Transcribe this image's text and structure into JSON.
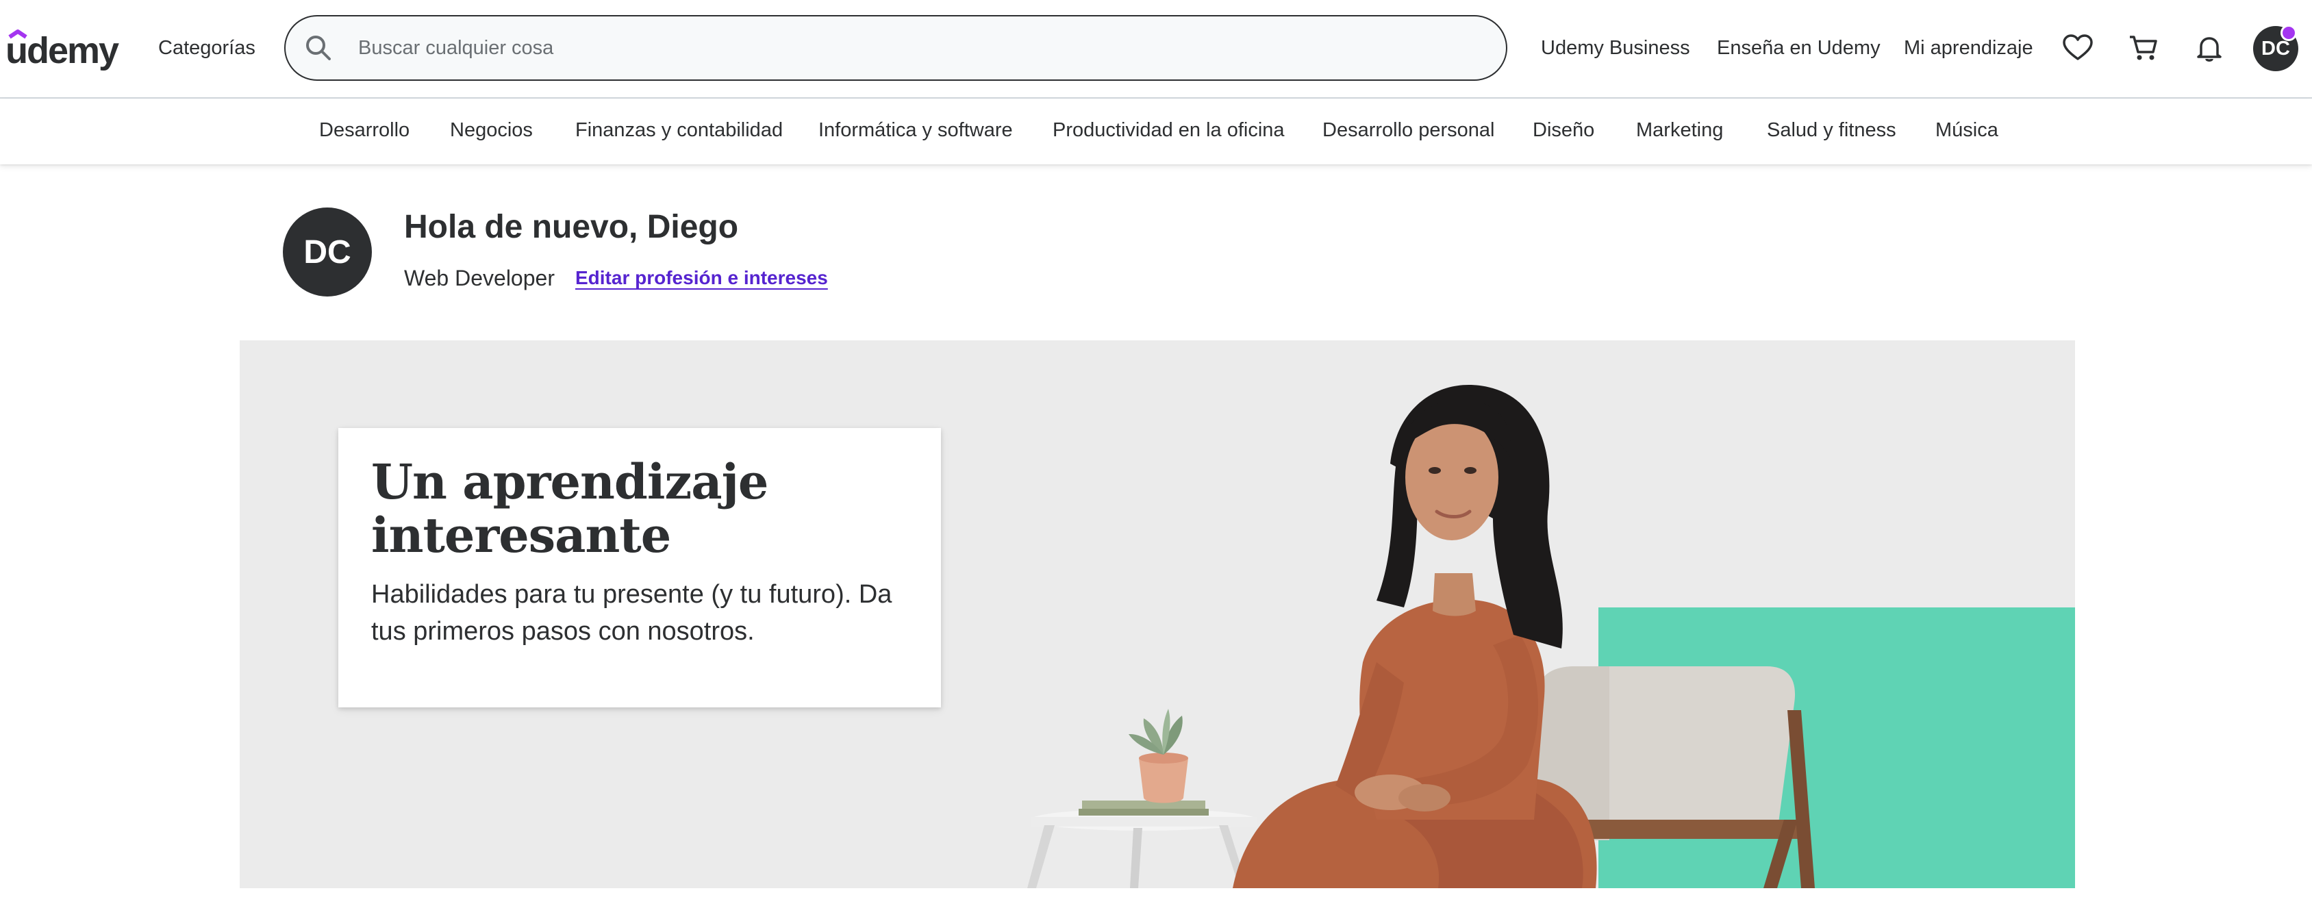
{
  "header": {
    "logo_text": "udemy",
    "categories_label": "Categorías",
    "search_placeholder": "Buscar cualquier cosa",
    "links": {
      "business": "Udemy Business",
      "teach": "Enseña en Udemy",
      "my_learning": "Mi aprendizaje"
    },
    "icons": [
      "heart-icon",
      "cart-icon",
      "bell-icon"
    ],
    "user_initials": "DC"
  },
  "category_bar": {
    "items": [
      "Desarrollo",
      "Negocios",
      "Finanzas y contabilidad",
      "Informática y software",
      "Productividad en la oficina",
      "Desarrollo personal",
      "Diseño",
      "Marketing",
      "Salud y fitness",
      "Música"
    ]
  },
  "welcome": {
    "initials": "DC",
    "title": "Hola de nuevo, Diego",
    "role": "Web Developer",
    "edit_link": "Editar profesión e intereses"
  },
  "banner": {
    "title": "Un aprendizaje interesante",
    "text": "Habilidades para tu presente (y tu futuro). Da tus primeros pasos con nosotros."
  },
  "colors": {
    "brand_purple": "#a435f0",
    "link_purple": "#5624d0",
    "text_dark": "#2d2f31",
    "banner_bg": "#ebebeb",
    "accent_teal": "#5fd3b4"
  }
}
